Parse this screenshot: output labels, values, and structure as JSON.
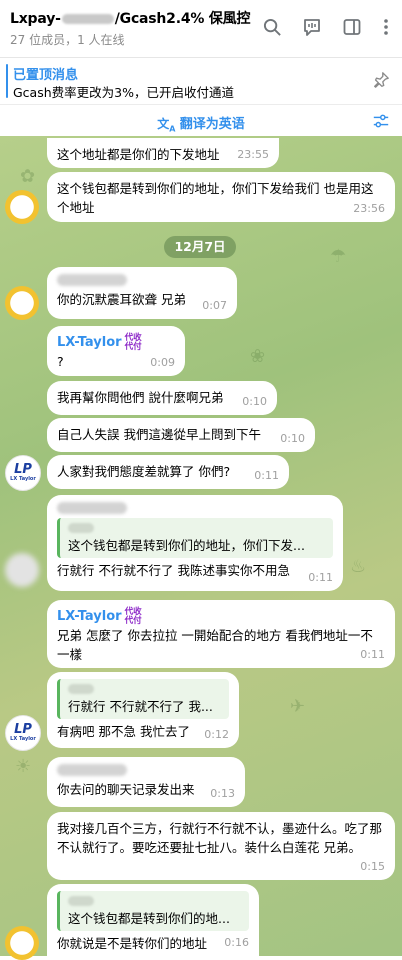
{
  "header": {
    "title_prefix": "Lxpay-",
    "title_suffix": "/Gcash2.4% 保風控",
    "subtitle": "27 位成员，1 人在线"
  },
  "pinned": {
    "title": "已置顶消息",
    "text": "Gcash费率更改为3%，已开启收付通道"
  },
  "translate_label": "翻译为英语",
  "date_separator": "12月7日",
  "messages": [
    {
      "text": "这个地址都是你们的下发地址",
      "time": "23:55"
    },
    {
      "text": "这个钱包都是转到你们的地址，你们下发给我们 也是用这个地址",
      "time": "23:56"
    },
    {
      "text": "你的沉默震耳欲聋 兄弟",
      "time": "0:07"
    },
    {
      "sender": "LX-Taylor",
      "badge_top": "代收",
      "badge_bottom": "代付",
      "text": "?",
      "time": "0:09"
    },
    {
      "text": "我再幫你問他們 說什麼啊兄弟",
      "time": "0:10"
    },
    {
      "text": "自己人失誤 我們這邊從早上問到下午",
      "time": "0:10"
    },
    {
      "text": "人家對我們態度差就算了 你們?",
      "time": "0:11"
    },
    {
      "quote": "这个钱包都是转到你们的地址，你们下发...",
      "text": "行就行 不行就不行了 我陈述事实你不用急",
      "time": "0:11"
    },
    {
      "sender": "LX-Taylor",
      "badge_top": "代收",
      "badge_bottom": "代付",
      "text": "兄弟 怎麼了 你去拉拉 一開始配合的地方 看我們地址一不一樣",
      "time": "0:11"
    },
    {
      "quote": "行就行 不行就不行了 我...",
      "text": "有病吧 那不急 我忙去了",
      "time": "0:12"
    },
    {
      "text": "你去问的聊天记录发出来",
      "time": "0:13"
    },
    {
      "text": "我对接几百个三方，行就行不行就不认，墨迹什么。吃了那不认就行了。要吃还要扯七扯八。装什么白莲花 兄弟。",
      "time": "0:15"
    },
    {
      "quote": "这个钱包都是转到你们的地...",
      "text": "你就说是不是转你们的地址",
      "time": "0:16"
    }
  ],
  "avatar_logo": {
    "main": "LP",
    "sub": "LX Taylor"
  },
  "colors": {
    "accent": "#3390ec",
    "badge": "#8d29c8",
    "quote_bar": "#59b55e",
    "background": "#a3c483"
  }
}
